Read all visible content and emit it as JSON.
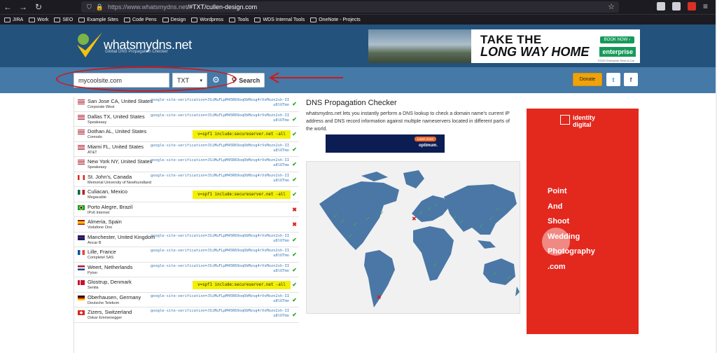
{
  "browser": {
    "url_host": "https://www.whatsmydns.net",
    "url_path": "/#TXT/cullen-design.com",
    "bookmarks": [
      "JIRA",
      "Work",
      "SEO",
      "Example Sites",
      "Code Pens",
      "Design",
      "Wordpress",
      "Tools",
      "WDS Internal Tools",
      "OneNote - Projects"
    ]
  },
  "header": {
    "logo_text": "whatsmydns.net",
    "logo_subtitle": "Global DNS Propagation Checker",
    "ad": {
      "headline_1": "TAKE THE",
      "headline_2": "LONG WAY HOME",
      "cta": "BOOK NOW ›",
      "brand": "enterprise",
      "legal": "©2022 Enterprise Rent-A-Car"
    }
  },
  "search": {
    "domain_value": "mycoolsite.com",
    "record_type": "TXT",
    "button_label": "Search",
    "donate_label": "Donate",
    "twitter_glyph": "t",
    "facebook_glyph": "f"
  },
  "results": [
    {
      "location": "San Jose CA, United States",
      "provider": "Corporate West",
      "flag": "us",
      "result": "google-site-verification=JSiMuFLpM45R69oqObMzsg4rVsMozn2sh-IIu8lUTmo",
      "spf": false,
      "status": "ok"
    },
    {
      "location": "Dallas TX, United States",
      "provider": "Speakeasy",
      "flag": "us",
      "result": "google-site-verification=JSiMuFLpM45R69oqObMzsg4rVsMozn2sh-IIu8lUTmo",
      "spf": false,
      "status": "ok"
    },
    {
      "location": "Dothan AL, United States",
      "provider": "Comodo",
      "flag": "us",
      "result": "v=spf1 include:secureserver.net -all",
      "spf": true,
      "status": "ok"
    },
    {
      "location": "Miami FL, United States",
      "provider": "AT&T",
      "flag": "us",
      "result": "google-site-verification=JSiMuFLpM45R69oqObMzsg4rVsMozn2sh-IIu8lUTmo",
      "spf": false,
      "status": "ok"
    },
    {
      "location": "New York NY, United States",
      "provider": "Speakeasy",
      "flag": "us",
      "result": "google-site-verification=JSiMuFLpM45R69oqObMzsg4rVsMozn2sh-IIu8lUTmo",
      "spf": false,
      "status": "ok"
    },
    {
      "location": "St. John's, Canada",
      "provider": "Memorial University of Newfoundland",
      "flag": "ca",
      "result": "google-site-verification=JSiMuFLpM45R69oqObMzsg4rVsMozn2sh-IIu8lUTmo",
      "spf": false,
      "status": "ok"
    },
    {
      "location": "Culiacan, Mexico",
      "provider": "Megacable",
      "flag": "mx",
      "result": "v=spf1 include:secureserver.net -all",
      "spf": true,
      "status": "ok"
    },
    {
      "location": "Porto Alegre, Brazil",
      "provider": "IPv6 Internet",
      "flag": "br",
      "result": "",
      "spf": false,
      "status": "fail"
    },
    {
      "location": "Almeria, Spain",
      "provider": "Vodafone Ono",
      "flag": "es",
      "result": "",
      "spf": false,
      "status": "fail"
    },
    {
      "location": "Manchester, United Kingdom",
      "provider": "Ancar B",
      "flag": "gb",
      "result": "google-site-verification=JSiMuFLpM45R69oqObMzsg4rVsMozn2sh-IIu8lUTmo",
      "spf": false,
      "status": "ok"
    },
    {
      "location": "Lille, France",
      "provider": "Completel SAS",
      "flag": "fr",
      "result": "google-site-verification=JSiMuFLpM45R69oqObMzsg4rVsMozn2sh-IIu8lUTmo",
      "spf": false,
      "status": "ok"
    },
    {
      "location": "Weert, Netherlands",
      "provider": "Pyton",
      "flag": "nl",
      "result": "google-site-verification=JSiMuFLpM45R69oqObMzsg4rVsMozn2sh-IIu8lUTmo",
      "spf": false,
      "status": "ok"
    },
    {
      "location": "Glostrup, Denmark",
      "provider": "Sentia",
      "flag": "dk",
      "result": "v=spf1 include:secureserver.net -all",
      "spf": true,
      "status": "ok"
    },
    {
      "location": "Oberhausen, Germany",
      "provider": "Deutsche Telekom",
      "flag": "de",
      "result": "google-site-verification=JSiMuFLpM45R69oqObMzsg4rVsMozn2sh-IIu8lUTmo",
      "spf": false,
      "status": "ok"
    },
    {
      "location": "Zizers, Switzerland",
      "provider": "Oskar Emmenegger",
      "flag": "ch",
      "result": "google-site-verification=JSiMuFLpM45R69oqObMzsg4rVsMozn2sh-IIu8lUTmo",
      "spf": false,
      "status": "ok"
    }
  ],
  "main": {
    "title": "DNS Propagation Checker",
    "intro": "whatsmydns.net lets you instantly perform a DNS lookup to check a domain name's current IP address and DNS record information against multiple nameservers located in different parts of the world.",
    "mid_ad": {
      "cta": "Learn more",
      "brand": "optimum."
    }
  },
  "side_ad": {
    "brand_line_1": "identity",
    "brand_line_2": "digital",
    "lines": [
      "Point",
      "And",
      "Shoot",
      "Wedding",
      "Photography",
      ".com"
    ]
  },
  "colors": {
    "header_bg": "#23527c",
    "search_bg": "#4479a8",
    "ok": "#2aa52a",
    "fail": "#d32222",
    "spf_highlight": "#f3f000",
    "annotation": "#d01818"
  }
}
